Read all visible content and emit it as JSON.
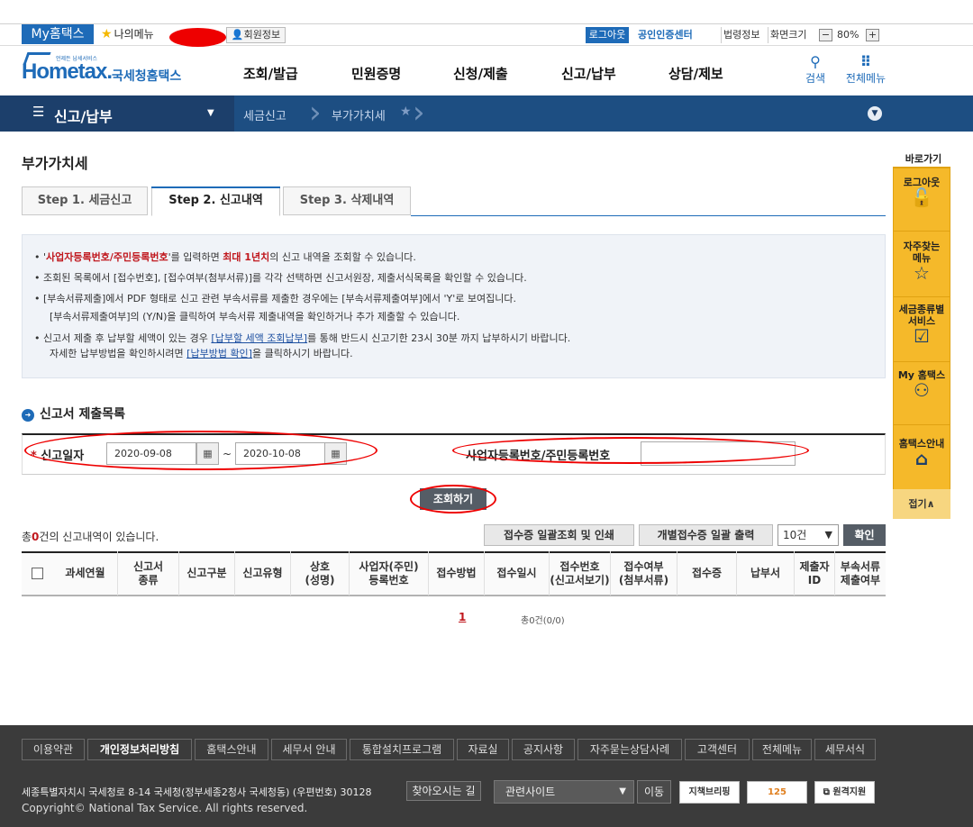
{
  "topbar": {
    "myhome": "My홈택스",
    "mymenu": "나의메뉴",
    "member_info": "회원정보",
    "logout": "로그아웃",
    "cert_center": "공인인증센터",
    "laws": "법령정보",
    "screen_size": "화면크기",
    "zoom_minus": "−",
    "zoom_value": "80%",
    "zoom_plus": "+"
  },
  "header": {
    "logo_main": "Hometax.",
    "logo_sub": "국세청홈택스",
    "logo_small": "언제든 납세서비스",
    "gnb": [
      "조회/발급",
      "민원증명",
      "신청/제출",
      "신고/납부",
      "상담/제보"
    ],
    "search_label": "검색",
    "allmenu_label": "전체메뉴"
  },
  "navbar": {
    "menu_label": "신고/납부",
    "breadcrumb": [
      "세금신고",
      "부가가치세"
    ]
  },
  "page": {
    "title": "부가가치세",
    "tabs": [
      "Step 1. 세금신고",
      "Step 2. 신고내역",
      "Step 3. 삭제내역"
    ]
  },
  "info": {
    "line1_pre": "'",
    "line1_b1": "사업자등록번호/주민등록번호",
    "line1_mid": "'를 입력하면 ",
    "line1_b2": "최대 1년치",
    "line1_post": "의 신고 내역을 조회할 수 있습니다.",
    "line2": "조회된 목록에서 [접수번호], [접수여부(첨부서류)]를 각각 선택하면 신고서원장, 제출서식목록을 확인할 수 있습니다.",
    "line3": "[부속서류제출]에서 PDF 형태로 신고 관련 부속서류를 제출한 경우에는 [부속서류제출여부]에서 'Y'로 보여집니다.",
    "line3b": "[부속서류제출여부]의 (Y/N)을 클릭하여 부속서류 제출내역을 확인하거나 추가 제출할 수 있습니다.",
    "line4_pre": "신고서 제출 후 납부할 세액이 있는 경우 ",
    "line4_link": "[납부할 세액 조회납부]",
    "line4_post": "를 통해 반드시 신고기한 23시 30분 까지 납부하시기 바랍니다.",
    "line4b_pre": "자세한 납부방법을 확인하시려면 ",
    "line4b_link": "[납부방법 확인]",
    "line4b_post": "을 클릭하시기 바랍니다."
  },
  "search": {
    "section_title": "신고서 제출목록",
    "date_label": "신고일자",
    "date_from": "2020-09-08",
    "date_to": "2020-10-08",
    "tilde": "~",
    "bizno_label": "사업자등록번호/주민등록번호",
    "bizno_value": "",
    "search_button": "조회하기"
  },
  "results": {
    "total_pre": "총",
    "total_count": "0",
    "total_post": "건의 신고내역이 있습니다.",
    "btn_batch": "접수증 일괄조회 및 인쇄",
    "btn_indiv": "개별접수증 일괄 출력",
    "count_select": "10건",
    "confirm": "확인",
    "columns": [
      "과세연월",
      "신고서\n종류",
      "신고구분",
      "신고유형",
      "상호\n(성명)",
      "사업자(주민)\n등록번호",
      "접수방법",
      "접수일시",
      "접수번호\n(신고서보기)",
      "접수여부\n(첨부서류)",
      "접수증",
      "납부서",
      "제출자\nID",
      "부속서류\n제출여부"
    ],
    "page": "1",
    "page_total": "총0건(0/0)"
  },
  "quick": {
    "title": "바로가기",
    "items": [
      "로그아웃",
      "자주찾는\n메뉴",
      "세금종류별\n서비스",
      "My 홈택스",
      "홈택스안내"
    ],
    "fold": "접기∧"
  },
  "footer": {
    "links": [
      "이용약관",
      "개인정보처리방침",
      "홈택스안내",
      "세무서 안내",
      "통합설치프로그램",
      "자료실",
      "공지사항",
      "자주묻는상담사례",
      "고객센터",
      "전체메뉴",
      "세무서식"
    ],
    "address": "세종특별자치시 국세청로 8-14 국세청(정부세종2청사 국세청동) (우편번호) 30128",
    "find_way": "찾아오시는 길",
    "copyright": "Copyright© National Tax Service. All rights reserved.",
    "related_site": "관련사이트",
    "go": "이동",
    "banners": [
      "지책브리핑",
      "125",
      "원격지원"
    ]
  },
  "colors": {
    "brand_blue": "#1e6bb8",
    "nav_dark": "#1c3f6b",
    "accent_red": "#c0171d",
    "quick_yellow": "#f5b92a",
    "footer_bg": "#3b3b3b"
  }
}
